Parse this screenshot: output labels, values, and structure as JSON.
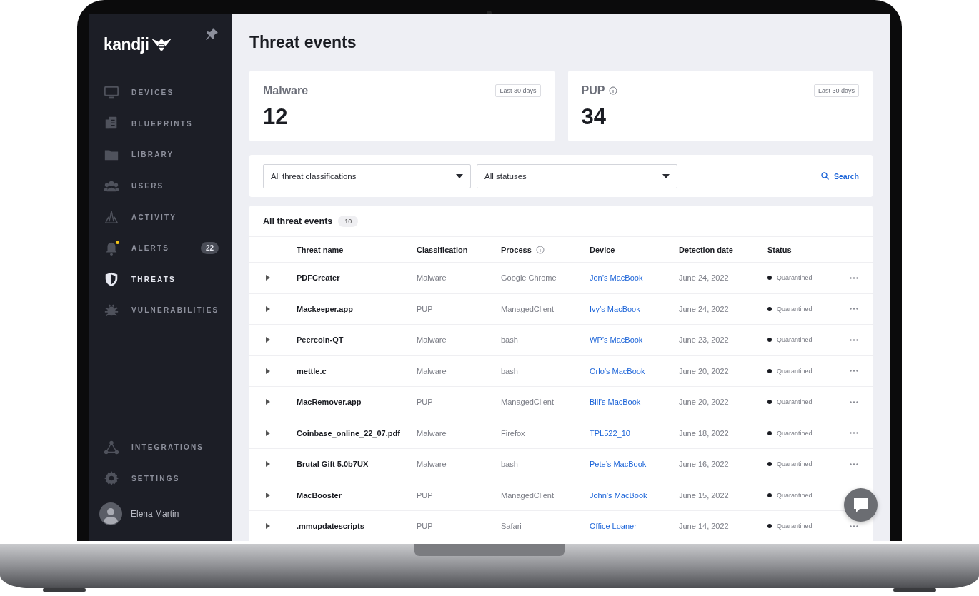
{
  "sidebar": {
    "logo": "kandji",
    "nav": [
      {
        "label": "DEVICES",
        "selected": false
      },
      {
        "label": "BLUEPRINTS",
        "selected": false
      },
      {
        "label": "LIBRARY",
        "selected": false
      },
      {
        "label": "USERS",
        "selected": false
      },
      {
        "label": "ACTIVITY",
        "selected": false
      },
      {
        "label": "ALERTS",
        "selected": false,
        "badge": "22",
        "notification": true
      },
      {
        "label": "THREATS",
        "selected": true
      },
      {
        "label": "VULNERABILITIES",
        "selected": false
      }
    ],
    "bottom_nav": [
      {
        "label": "INTEGRATIONS",
        "selected": false
      },
      {
        "label": "SETTINGS",
        "selected": false
      }
    ],
    "user": {
      "name": "Elena Martin"
    }
  },
  "page_title": "Threat events",
  "summary_cards": [
    {
      "label": "Malware",
      "info": false,
      "period": "Last 30 days",
      "count": "12"
    },
    {
      "label": "PUP",
      "info": true,
      "period": "Last 30 days",
      "count": "34"
    }
  ],
  "filters": {
    "dropdowns": [
      {
        "value": "All threat classifications"
      },
      {
        "value": "All statuses"
      }
    ],
    "search_label": "Search"
  },
  "table": {
    "title": "All threat events",
    "count": "10",
    "columns": [
      {
        "label": "Threat name",
        "info": false
      },
      {
        "label": "Classification",
        "info": false
      },
      {
        "label": "Process",
        "info": true
      },
      {
        "label": "Device",
        "info": false
      },
      {
        "label": "Detection date",
        "info": false
      },
      {
        "label": "Status",
        "info": false
      }
    ],
    "rows": [
      {
        "name": "PDFCreater",
        "classification": "Malware",
        "process": "Google Chrome",
        "device": "Jon’s MacBook",
        "date": "June 24, 2022",
        "status": "Quarantined"
      },
      {
        "name": "Mackeeper.app",
        "classification": "PUP",
        "process": "ManagedClient",
        "device": "Ivy’s MacBook",
        "date": "June 24, 2022",
        "status": "Quarantined"
      },
      {
        "name": "Peercoin-QT",
        "classification": "Malware",
        "process": "bash",
        "device": "WP’s MacBook",
        "date": "June 23, 2022",
        "status": "Quarantined"
      },
      {
        "name": "mettle.c",
        "classification": "Malware",
        "process": "bash",
        "device": "Orlo’s MacBook",
        "date": "June 20, 2022",
        "status": "Quarantined"
      },
      {
        "name": "MacRemover.app",
        "classification": "PUP",
        "process": "ManagedClient",
        "device": "Bill’s MacBook",
        "date": "June 20, 2022",
        "status": "Quarantined"
      },
      {
        "name": "Coinbase_online_22_07.pdf",
        "classification": "Malware",
        "process": "Firefox",
        "device": "TPL522_10",
        "date": "June 18, 2022",
        "status": "Quarantined"
      },
      {
        "name": "Brutal Gift 5.0b7UX",
        "classification": "Malware",
        "process": "bash",
        "device": "Pete’s MacBook",
        "date": "June 16, 2022",
        "status": "Quarantined"
      },
      {
        "name": "MacBooster",
        "classification": "PUP",
        "process": "ManagedClient",
        "device": "John’s MacBook",
        "date": "June 15, 2022",
        "status": "Quarantined"
      },
      {
        "name": ".mmupdatescripts",
        "classification": "PUP",
        "process": "Safari",
        "device": "Office Loaner",
        "date": "June 14, 2022",
        "status": "Quarantined"
      }
    ]
  }
}
